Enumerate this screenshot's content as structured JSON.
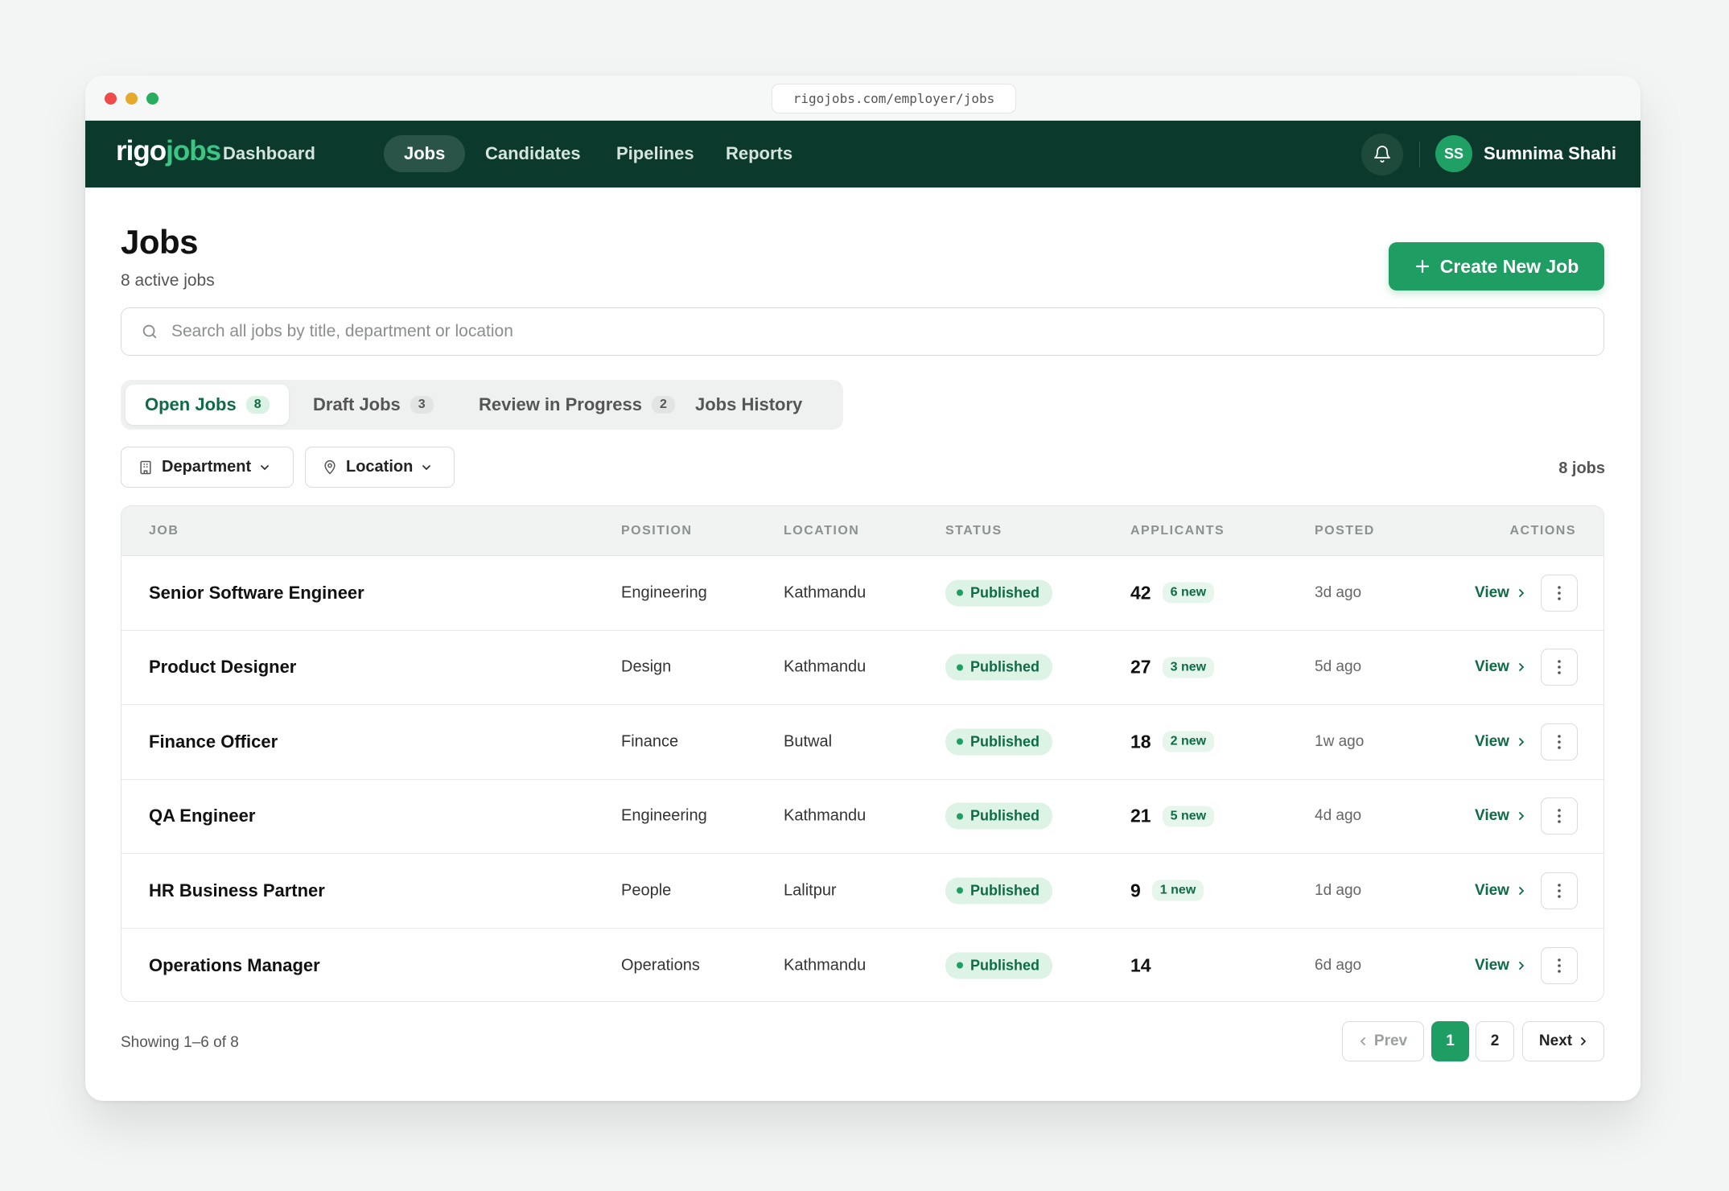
{
  "browser": {
    "url": "rigojobs.com/employer/jobs"
  },
  "nav": {
    "logo_a": "rigo",
    "logo_b": "jobs",
    "items": [
      {
        "label": "Dashboard"
      },
      {
        "label": "Jobs"
      },
      {
        "label": "Candidates"
      },
      {
        "label": "Pipelines"
      },
      {
        "label": "Reports"
      }
    ],
    "user_initials": "SS",
    "user_name": "Sumnima Shahi"
  },
  "header": {
    "title": "Jobs",
    "subtitle": "8 active jobs",
    "create_label": "Create New Job"
  },
  "search": {
    "placeholder": "Search all jobs by title, department or location"
  },
  "tabs": [
    {
      "label": "Open Jobs",
      "count": "8"
    },
    {
      "label": "Draft Jobs",
      "count": "3"
    },
    {
      "label": "Review in Progress",
      "count": "2"
    },
    {
      "label": "Jobs History",
      "count": ""
    }
  ],
  "filters": {
    "department": "Department",
    "location": "Location",
    "job_count": "8 jobs"
  },
  "table": {
    "columns": [
      "JOB",
      "POSITION",
      "LOCATION",
      "STATUS",
      "APPLICANTS",
      "POSTED",
      "ACTIONS"
    ],
    "rows": [
      {
        "job": "Senior Software Engineer",
        "position": "Engineering",
        "location": "Kathmandu",
        "status": "Published",
        "applicants": "42",
        "new": "6 new",
        "posted": "3d ago",
        "action": "View"
      },
      {
        "job": "Product Designer",
        "position": "Design",
        "location": "Kathmandu",
        "status": "Published",
        "applicants": "27",
        "new": "3 new",
        "posted": "5d ago",
        "action": "View"
      },
      {
        "job": "Finance Officer",
        "position": "Finance",
        "location": "Butwal",
        "status": "Published",
        "applicants": "18",
        "new": "2 new",
        "posted": "1w ago",
        "action": "View"
      },
      {
        "job": "QA Engineer",
        "position": "Engineering",
        "location": "Kathmandu",
        "status": "Published",
        "applicants": "21",
        "new": "5 new",
        "posted": "4d ago",
        "action": "View"
      },
      {
        "job": "HR Business Partner",
        "position": "People",
        "location": "Lalitpur",
        "status": "Published",
        "applicants": "9",
        "new": "1 new",
        "posted": "1d ago",
        "action": "View"
      },
      {
        "job": "Operations Manager",
        "position": "Operations",
        "location": "Kathmandu",
        "status": "Published",
        "applicants": "14",
        "new": "",
        "posted": "6d ago",
        "action": "View"
      }
    ]
  },
  "pagination": {
    "showing": "Showing 1–6 of 8",
    "prev": "Prev",
    "page1": "1",
    "page2": "2",
    "next": "Next"
  },
  "colors": {
    "nav_bg": "#0b3a2c",
    "accent": "#1f9e63",
    "accent_text": "#0f6b45"
  }
}
